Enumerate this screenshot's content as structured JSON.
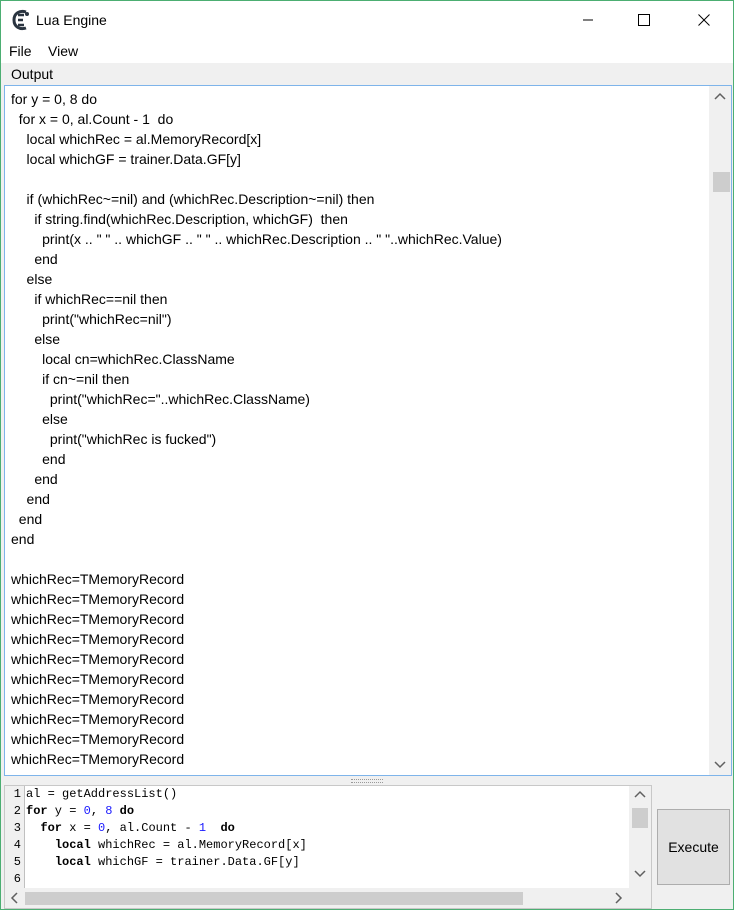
{
  "window": {
    "title": "Lua Engine"
  },
  "menu": {
    "file": "File",
    "view": "View"
  },
  "output": {
    "label": "Output",
    "text": "for y = 0, 8 do\n  for x = 0, al.Count - 1  do\n    local whichRec = al.MemoryRecord[x]\n    local whichGF = trainer.Data.GF[y]\n\n    if (whichRec~=nil) and (whichRec.Description~=nil) then\n      if string.find(whichRec.Description, whichGF)  then\n        print(x .. \" \" .. whichGF .. \" \" .. whichRec.Description .. \" \"..whichRec.Value)\n      end\n    else\n      if whichRec==nil then\n        print(\"whichRec=nil\")\n      else\n        local cn=whichRec.ClassName\n        if cn~=nil then\n          print(\"whichRec=\"..whichRec.ClassName)\n        else\n          print(\"whichRec is fucked\")\n        end\n      end\n    end\n  end\nend\n\nwhichRec=TMemoryRecord\nwhichRec=TMemoryRecord\nwhichRec=TMemoryRecord\nwhichRec=TMemoryRecord\nwhichRec=TMemoryRecord\nwhichRec=TMemoryRecord\nwhichRec=TMemoryRecord\nwhichRec=TMemoryRecord\nwhichRec=TMemoryRecord\nwhichRec=TMemoryRecord"
  },
  "editor": {
    "line_numbers": [
      "1",
      "2",
      "3",
      "4",
      "5",
      "6"
    ],
    "lines": [
      [
        {
          "t": "al = getAddressList()",
          "c": ""
        }
      ],
      [
        {
          "t": "for",
          "c": "kw"
        },
        {
          "t": " y = ",
          "c": ""
        },
        {
          "t": "0",
          "c": "num"
        },
        {
          "t": ", ",
          "c": ""
        },
        {
          "t": "8",
          "c": "num"
        },
        {
          "t": " ",
          "c": ""
        },
        {
          "t": "do",
          "c": "kw"
        }
      ],
      [
        {
          "t": "  ",
          "c": ""
        },
        {
          "t": "for",
          "c": "kw"
        },
        {
          "t": " x = ",
          "c": ""
        },
        {
          "t": "0",
          "c": "num"
        },
        {
          "t": ", al.Count - ",
          "c": ""
        },
        {
          "t": "1",
          "c": "num"
        },
        {
          "t": "  ",
          "c": ""
        },
        {
          "t": "do",
          "c": "kw"
        }
      ],
      [
        {
          "t": "    ",
          "c": ""
        },
        {
          "t": "local",
          "c": "kw"
        },
        {
          "t": " whichRec = al.MemoryRecord[x]",
          "c": ""
        }
      ],
      [
        {
          "t": "    ",
          "c": ""
        },
        {
          "t": "local",
          "c": "kw"
        },
        {
          "t": " whichGF = trainer.Data.GF[y]",
          "c": ""
        }
      ],
      [
        {
          "t": "",
          "c": ""
        }
      ]
    ]
  },
  "execute_button": "Execute"
}
